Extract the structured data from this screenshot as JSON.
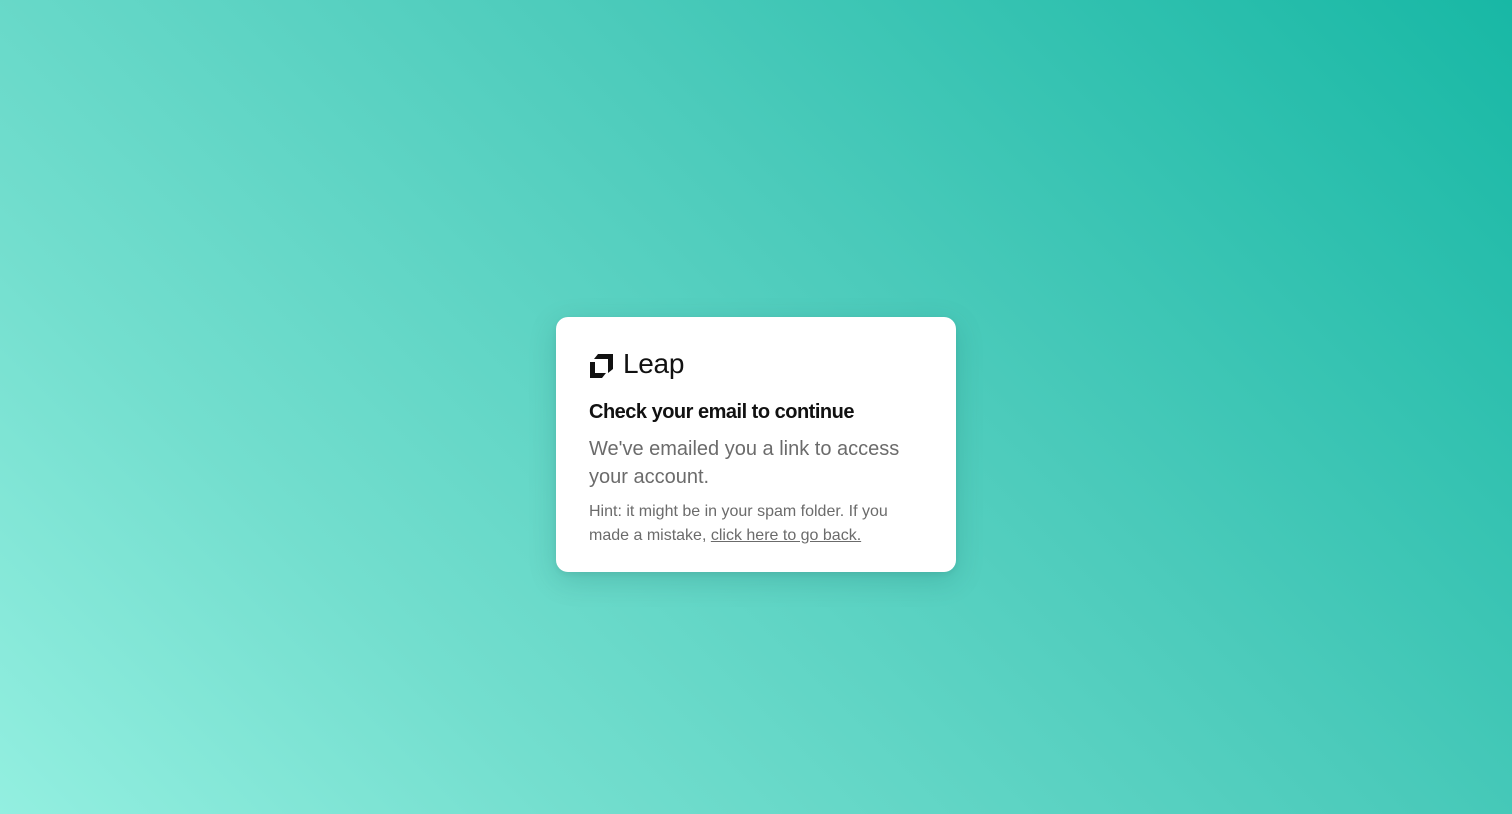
{
  "brand": {
    "name": "Leap",
    "icon": "leap-logo-icon"
  },
  "card": {
    "title": "Check your email to continue",
    "subtitle": "We've emailed you a link to access your account.",
    "hint_text": "Hint: it might be in your spam folder. If you made a mistake,",
    "back_link": "click here to go back."
  },
  "colors": {
    "background_start": "#93efe0",
    "background_end": "#18b8a5",
    "card_background": "#ffffff",
    "heading": "#111111",
    "body_text": "#6b6b6b"
  }
}
